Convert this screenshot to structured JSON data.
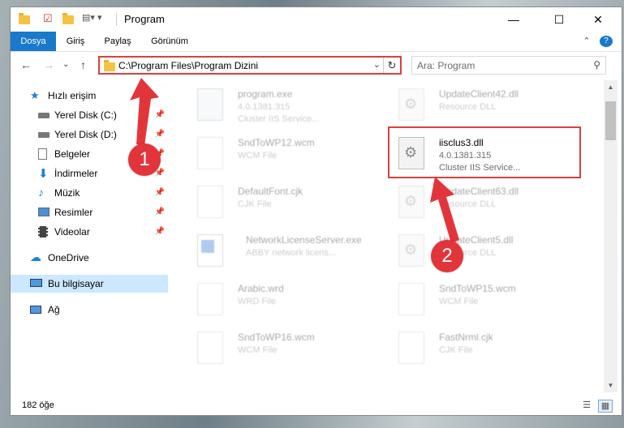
{
  "window": {
    "title": "Program",
    "controls": {
      "minimize": "—",
      "maximize": "☐",
      "close": "✕"
    }
  },
  "ribbon": {
    "tabs": [
      "Dosya",
      "Giriş",
      "Paylaş",
      "Görünüm"
    ],
    "collapse": "⌃",
    "help": "?"
  },
  "address": {
    "path": "C:\\Program Files\\Program Dizini",
    "dropdown": "⌄",
    "refresh": "↻"
  },
  "search": {
    "placeholder": "Ara: Program"
  },
  "nav": {
    "back": "←",
    "forward": "→",
    "recent": "⌄",
    "up": "↑"
  },
  "sidebar": {
    "quick_access": "Hızlı erişim",
    "items": [
      {
        "label": "Yerel Disk (C:)",
        "icon": "drive-icon"
      },
      {
        "label": "Yerel Disk (D:)",
        "icon": "drive-icon"
      },
      {
        "label": "Belgeler",
        "icon": "documents-icon"
      },
      {
        "label": "İndirmeler",
        "icon": "downloads-icon"
      },
      {
        "label": "Müzik",
        "icon": "music-icon"
      },
      {
        "label": "Resimler",
        "icon": "pictures-icon"
      },
      {
        "label": "Videolar",
        "icon": "videos-icon"
      }
    ],
    "onedrive": "OneDrive",
    "this_pc": "Bu bilgisayar",
    "network": "Ağ"
  },
  "files": [
    {
      "name": "program.exe",
      "sub1": "4.0.1381.315",
      "sub2": "Cluster IIS Service...",
      "type": "exe"
    },
    {
      "name": "UpdateClient42.dll",
      "sub1": "Resource DLL",
      "sub2": "",
      "type": "dll"
    },
    {
      "name": "SndToWP12.wcm",
      "sub1": "WCM File",
      "sub2": "",
      "type": "doc"
    },
    {
      "name": "iisclus3.dll",
      "sub1": "4.0.1381.315",
      "sub2": "Cluster IIS Service...",
      "type": "dll"
    },
    {
      "name": "DefaultFont.cjk",
      "sub1": "CJK File",
      "sub2": "",
      "type": "doc"
    },
    {
      "name": "UpdateClient63.dll",
      "sub1": "Resource DLL",
      "sub2": "",
      "type": "dll"
    },
    {
      "name": "NetworkLicenseServer.exe",
      "sub1": "ABBY network licens...",
      "sub2": "",
      "type": "app"
    },
    {
      "name": "UpdateClient5.dll",
      "sub1": "Resource DLL",
      "sub2": "",
      "type": "dll"
    },
    {
      "name": "Arabic.wrd",
      "sub1": "WRD File",
      "sub2": "",
      "type": "doc"
    },
    {
      "name": "SndToWP15.wcm",
      "sub1": "WCM File",
      "sub2": "",
      "type": "doc"
    },
    {
      "name": "SndToWP16.wcm",
      "sub1": "WCM File",
      "sub2": "",
      "type": "doc"
    },
    {
      "name": "FastNrml.cjk",
      "sub1": "CJK File",
      "sub2": "",
      "type": "doc"
    }
  ],
  "status": {
    "count": "182 öğe"
  },
  "annotations": {
    "step1": "1",
    "step2": "2"
  },
  "colors": {
    "accent": "#1979ca",
    "highlight": "#d9413f",
    "badge": "#e2353b",
    "selection": "#cce8ff"
  }
}
